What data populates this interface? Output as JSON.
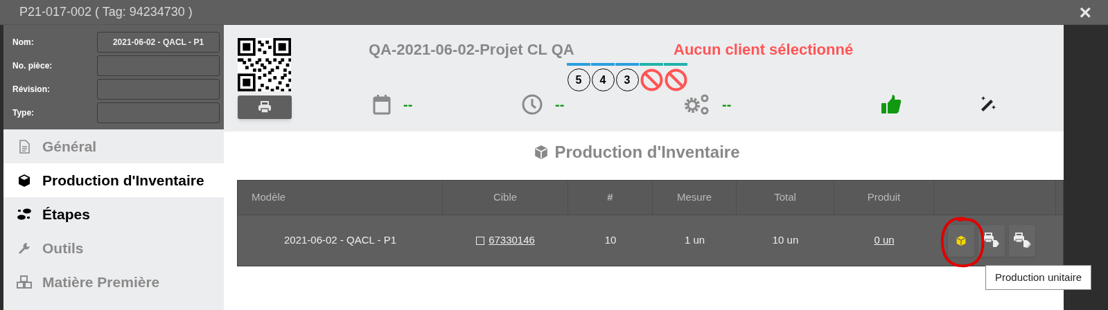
{
  "window": {
    "title": "P21-017-002 ( Tag: 94234730 )",
    "close": "×"
  },
  "form": [
    {
      "label": "Nom:",
      "value": "2021-06-02 - QACL - P1"
    },
    {
      "label": "No. pièce:"
    },
    {
      "label": "Révision:"
    },
    {
      "label": "Type:"
    }
  ],
  "sidebar": {
    "items": [
      {
        "kind": "document",
        "label": "Général",
        "selected": false,
        "disabled": true
      },
      {
        "kind": "box",
        "label": "Production d'Inventaire",
        "selected": true,
        "disabled": false
      },
      {
        "kind": "steps",
        "label": "Étapes",
        "selected": false,
        "disabled": false
      },
      {
        "kind": "wrench",
        "label": "Outils",
        "selected": false,
        "disabled": true
      },
      {
        "kind": "boxes",
        "label": "Matière Première",
        "selected": false,
        "disabled": true
      }
    ]
  },
  "header": {
    "project": "QA-2021-06-02-Projet CL QA",
    "client": "Aucun client sélectionné",
    "badges": [
      {
        "kind": "number",
        "label": "5",
        "color": "#2a9ee0"
      },
      {
        "kind": "number",
        "label": "4",
        "color": "#2a9ee0"
      },
      {
        "kind": "number",
        "label": "3",
        "color": "#2a9ee0"
      },
      {
        "kind": "blocked",
        "color": "#20b2aa"
      },
      {
        "kind": "blocked",
        "color": "#20b2aa"
      }
    ],
    "stats": [
      {
        "kind": "calendar",
        "value": "--"
      },
      {
        "kind": "clock",
        "value": "--"
      },
      {
        "kind": "gears",
        "value": "--"
      },
      {
        "kind": "thumbs-up"
      },
      {
        "kind": "wand"
      }
    ]
  },
  "section_title": "Production d'Inventaire",
  "table": {
    "columns": [
      "Modèle",
      "Cible",
      "#",
      "Mesure",
      "Total",
      "Produit"
    ],
    "rows": [
      {
        "modele": "2021-06-02 - QACL - P1",
        "cible": "67330146",
        "cible_checked": false,
        "count": "10",
        "mesure": "1 un",
        "total": "10 un",
        "produit": "0 un"
      }
    ]
  },
  "tooltip": "Production unitaire"
}
